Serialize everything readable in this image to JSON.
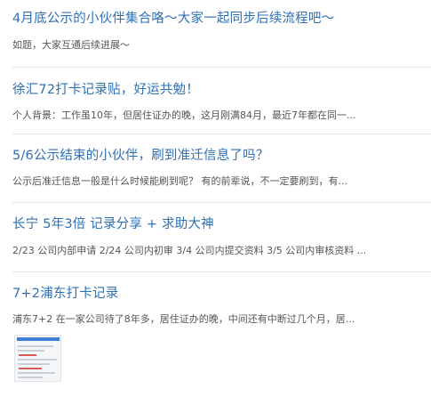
{
  "posts": [
    {
      "title": "4月底公示的小伙伴集合咯～大家一起同步后续流程吧～",
      "summary": "如题，大家互通后续进展～"
    },
    {
      "title": "徐汇72打卡记录贴，好运共勉！",
      "summary": "个人背景：工作虽10年，但居住证办的晚，这月刚满84月，最近7年都在同一..."
    },
    {
      "title": "5/6公示结束的小伙伴，刷到准迁信息了吗？",
      "summary": "公示后准迁信息一般是什么时候能刷到呢？ 有的前辈说，不一定要刷到，有..."
    },
    {
      "title": "长宁 5年3倍 记录分享 + 求助大神",
      "summary": "2/23 公司内部申请 2/24 公司内初审 3/4 公司内提交资料 3/5 公司内审核资料 ..."
    },
    {
      "title": "7+2浦东打卡记录",
      "summary": "浦东7+2 在一家公司待了8年多，居住证办的晚，中间还有中断过几个月，居..."
    }
  ],
  "colors": {
    "title": "#2f6fb3",
    "summary": "#555555",
    "divider": "#e4e4e4"
  },
  "icons": {
    "post_thumbnail": "document-screenshot-thumbnail"
  }
}
